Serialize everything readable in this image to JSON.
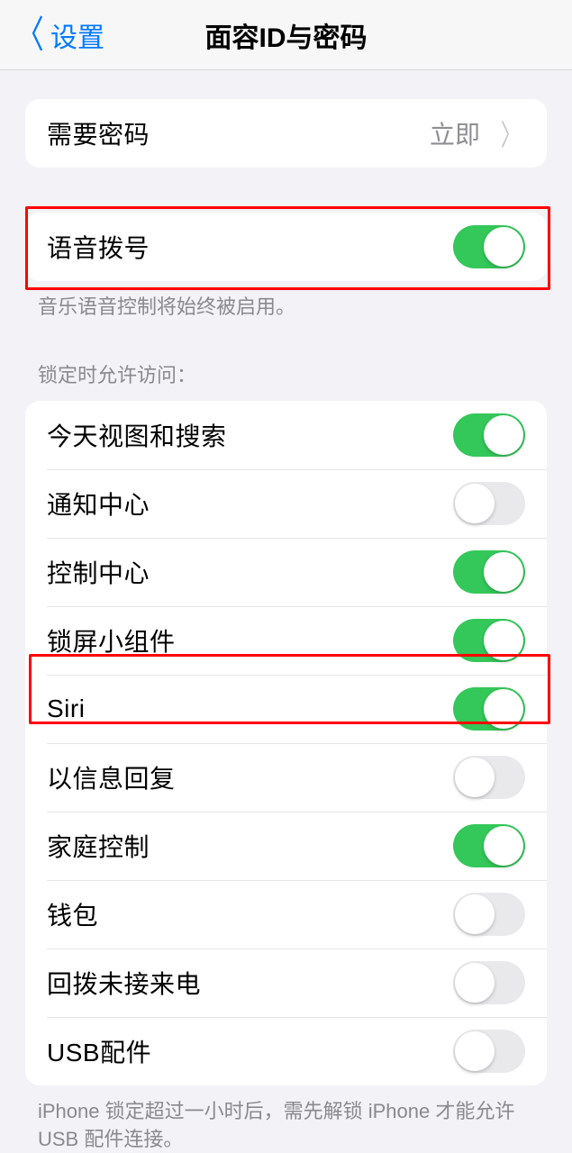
{
  "nav": {
    "back_label": "设置",
    "title": "面容ID与密码"
  },
  "passcode_section": {
    "label": "需要密码",
    "value": "立即"
  },
  "voice_section": {
    "label": "语音拨号",
    "enabled": true,
    "footer": "音乐语音控制将始终被启用。"
  },
  "lock_section": {
    "header": "锁定时允许访问：",
    "items": [
      {
        "label": "今天视图和搜索",
        "enabled": true
      },
      {
        "label": "通知中心",
        "enabled": false
      },
      {
        "label": "控制中心",
        "enabled": true
      },
      {
        "label": "锁屏小组件",
        "enabled": true
      },
      {
        "label": "Siri",
        "enabled": true
      },
      {
        "label": "以信息回复",
        "enabled": false
      },
      {
        "label": "家庭控制",
        "enabled": true
      },
      {
        "label": "钱包",
        "enabled": false
      },
      {
        "label": "回拨未接来电",
        "enabled": false
      },
      {
        "label": "USB配件",
        "enabled": false
      }
    ],
    "footer": "iPhone 锁定超过一小时后，需先解锁 iPhone 才能允许 USB 配件连接。"
  }
}
